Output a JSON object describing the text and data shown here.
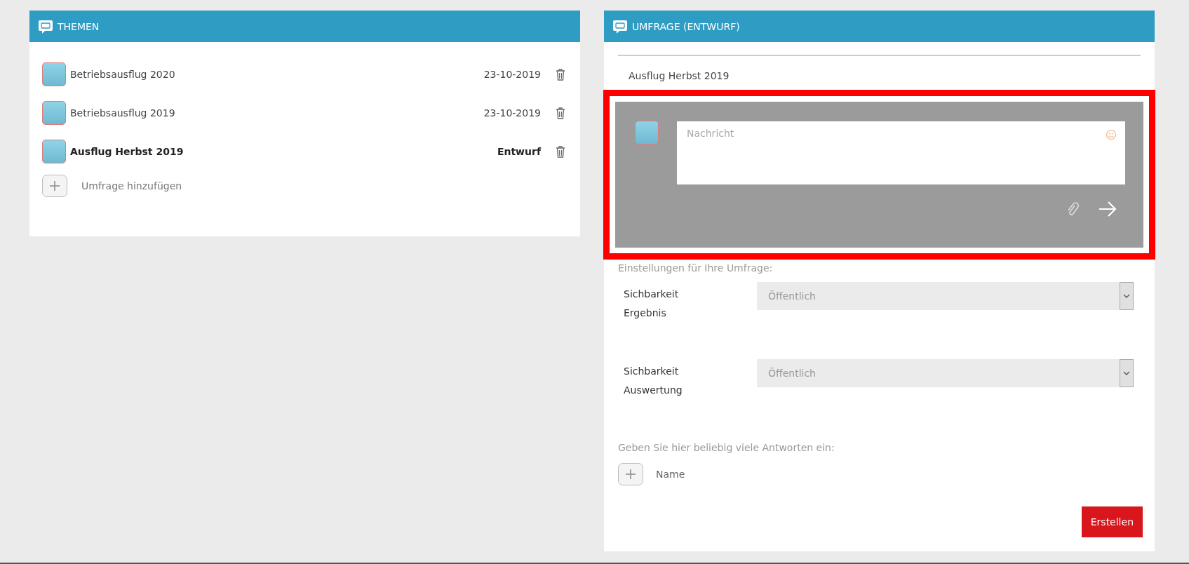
{
  "topics_panel": {
    "title": "THEMEN",
    "items": [
      {
        "title": "Betriebsausflug 2020",
        "meta": "23-10-2019",
        "selected": false
      },
      {
        "title": "Betriebsausflug 2019",
        "meta": "23-10-2019",
        "selected": false
      },
      {
        "title": "Ausflug Herbst 2019",
        "meta": "Entwurf",
        "selected": true
      }
    ],
    "add_label": "Umfrage hinzufügen"
  },
  "survey_panel": {
    "title": "UMFRAGE (ENTWURF)",
    "topic": "Ausflug Herbst 2019",
    "composer": {
      "highlighted": true,
      "placeholder": "Nachricht"
    },
    "settings_heading": "Einstellungen für Ihre Umfrage:",
    "settings": [
      {
        "label": "Sichbarkeit Ergebnis",
        "value": "Öffentlich"
      },
      {
        "label": "Sichbarkeit Auswertung",
        "value": "Öffentlich"
      }
    ],
    "answers_heading": "Geben Sie hier beliebig viele Antworten ein:",
    "answer_add_label": "Name",
    "submit": "Erstellen"
  }
}
